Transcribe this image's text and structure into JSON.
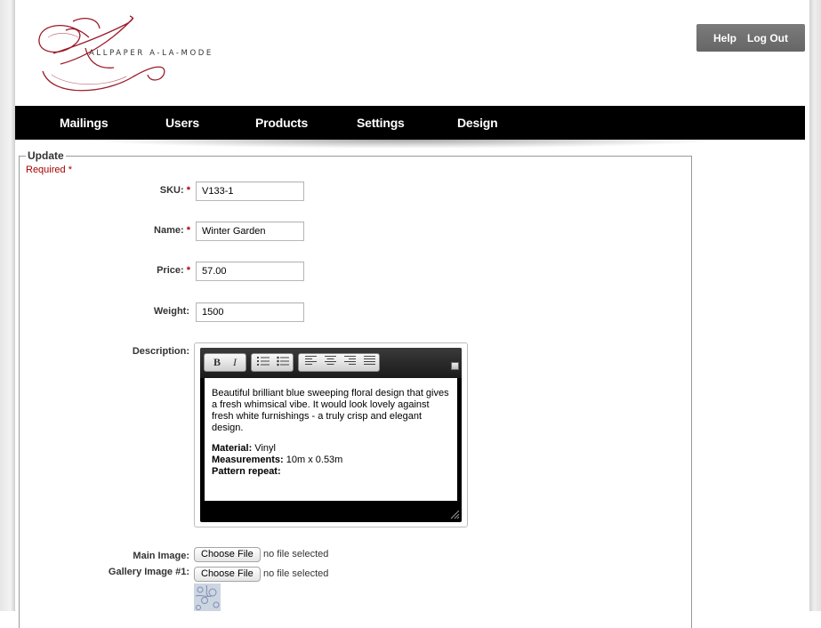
{
  "brand": {
    "logo_text": "ALLPAPER A-LA-MODE",
    "accent_color": "#9b1b2a"
  },
  "header": {
    "help": "Help",
    "logout": "Log Out"
  },
  "nav": {
    "items": [
      "Mailings",
      "Users",
      "Products",
      "Settings",
      "Design"
    ]
  },
  "form": {
    "legend": "Update",
    "required_note": "Required",
    "required_star": "*",
    "sku": {
      "label": "SKU:",
      "value": "V133-1"
    },
    "name": {
      "label": "Name:",
      "value": "Winter Garden"
    },
    "price": {
      "label": "Price:",
      "value": "57.00"
    },
    "weight": {
      "label": "Weight:",
      "value": "1500"
    },
    "description": {
      "label": "Description:",
      "toolbar": {
        "bold": "B",
        "italic": "I"
      },
      "paragraph": "Beautiful brilliant blue sweeping floral design that gives a fresh whimsical vibe. It would look lovely against fresh white furnishings - a truly crisp and elegant design.",
      "material_label": "Material:",
      "material_value": " Vinyl",
      "measurements_label": "Measurements:",
      "measurements_value": " 10m x 0.53m",
      "pattern_label": "Pattern repeat:"
    },
    "main_image": {
      "label": "Main Image:",
      "button": "Choose File",
      "status": "no file selected"
    },
    "gallery_image_1": {
      "label": "Gallery Image #1:",
      "button": "Choose File",
      "status": "no file selected"
    }
  }
}
